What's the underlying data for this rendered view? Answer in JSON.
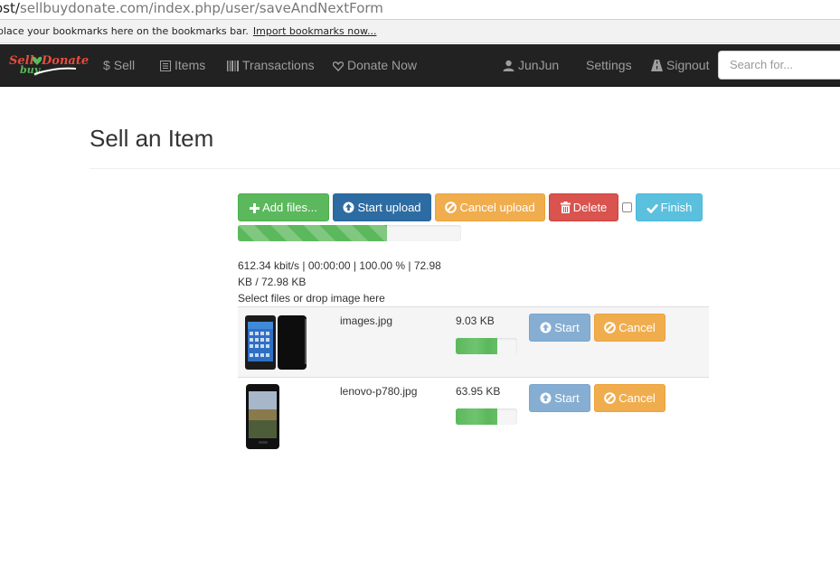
{
  "browser": {
    "url_lead": "ost/",
    "url_rest": "sellbuydonate.com/index.php/user/saveAndNextForm",
    "bookmarks_text": "place your bookmarks here on the bookmarks bar.",
    "bookmarks_link": "Import bookmarks now..."
  },
  "logo": {
    "sell": "Sell",
    "donate": "Donate",
    "buy": "buy"
  },
  "nav": {
    "sell": "Sell",
    "items": "Items",
    "transactions": "Transactions",
    "donate": "Donate Now",
    "user": "JunJun",
    "settings": "Settings",
    "signout": "Signout",
    "search_placeholder": "Search for..."
  },
  "page": {
    "title": "Sell an Item"
  },
  "toolbar": {
    "add_files": "Add files...",
    "start_upload": "Start upload",
    "cancel_upload": "Cancel upload",
    "delete": "Delete",
    "finish": "Finish",
    "global_progress": 0.67
  },
  "status": {
    "line1": "612.34 kbit/s | 00:00:00 | 100.00 % | 72.98",
    "line2": "KB / 72.98 KB",
    "drop_hint": "Select files or drop image here"
  },
  "files": [
    {
      "name": "images.jpg",
      "size": "9.03 KB",
      "progress": 0.68,
      "start": "Start",
      "cancel": "Cancel"
    },
    {
      "name": "lenovo-p780.jpg",
      "size": "63.95 KB",
      "progress": 0.68,
      "start": "Start",
      "cancel": "Cancel"
    }
  ],
  "colors": {
    "navbar": "#222222",
    "success": "#5cb85c",
    "primary": "#2d6ca2",
    "warning": "#f0ad4e",
    "danger": "#d9534f",
    "info": "#5bc0de"
  }
}
